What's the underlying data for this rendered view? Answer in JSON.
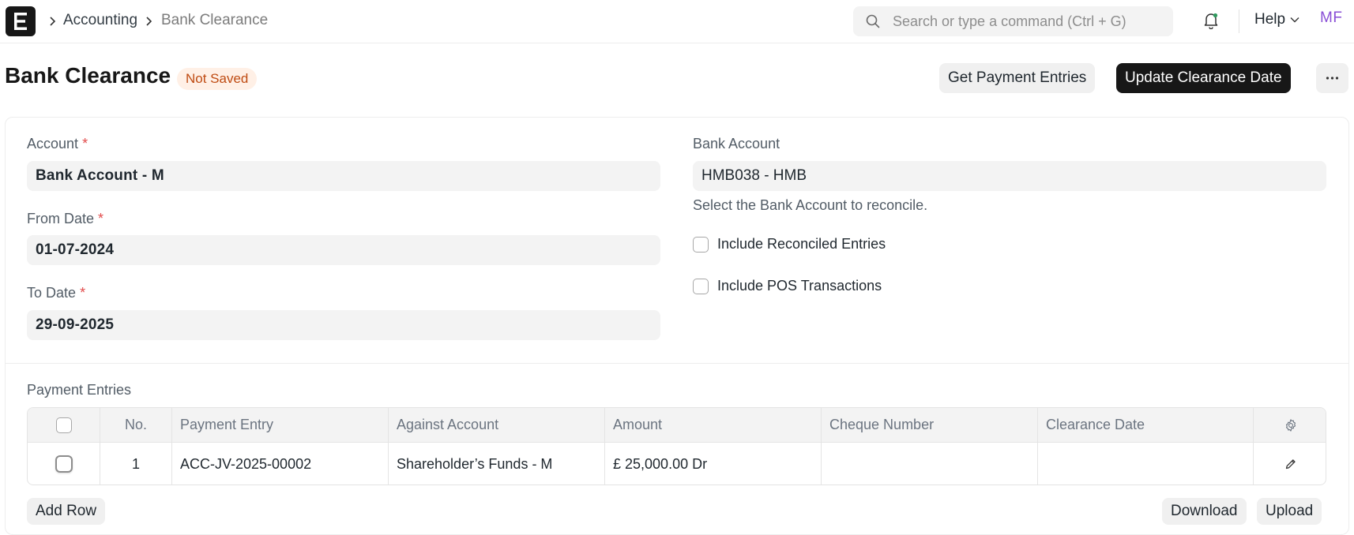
{
  "navbar": {
    "logo_letter": "E",
    "breadcrumbs": [
      "Accounting",
      "Bank Clearance"
    ],
    "search_placeholder": "Search or type a command (Ctrl + G)",
    "help_label": "Help",
    "avatar_initials": "MF"
  },
  "page": {
    "title": "Bank Clearance",
    "status": "Not Saved",
    "get_entries_label": "Get Payment Entries",
    "update_date_label": "Update Clearance Date",
    "more_label": "···"
  },
  "form": {
    "account_label": "Account",
    "account_value": "Bank Account - M",
    "from_date_label": "From Date",
    "from_date_value": "01-07-2024",
    "to_date_label": "To Date",
    "to_date_value": "29-09-2025",
    "required_mark": "*",
    "bank_account_label": "Bank Account",
    "bank_account_value": "HMB038 - HMB",
    "bank_account_desc": "Select the Bank Account to reconcile.",
    "include_reconciled_label": "Include Reconciled Entries",
    "include_reconciled_checked": false,
    "include_pos_label": "Include POS Transactions",
    "include_pos_checked": false
  },
  "payment_entries": {
    "section_label": "Payment Entries",
    "columns": [
      "No.",
      "Payment Entry",
      "Against Account",
      "Amount",
      "Cheque Number",
      "Clearance Date"
    ],
    "rows": [
      {
        "no": "1",
        "payment_entry": "ACC-JV-2025-00002",
        "against_account": "Shareholder’s Funds - M",
        "amount": "£ 25,000.00 Dr",
        "cheque_number": "",
        "clearance_date": ""
      }
    ],
    "add_row_label": "Add Row",
    "download_label": "Download",
    "upload_label": "Upload"
  },
  "colors": {
    "primary_button": "#171717",
    "status_bg": "#fff0e6",
    "status_text": "#bf4b12",
    "avatar": "#8a4fd6",
    "required": "#e24c4c"
  }
}
